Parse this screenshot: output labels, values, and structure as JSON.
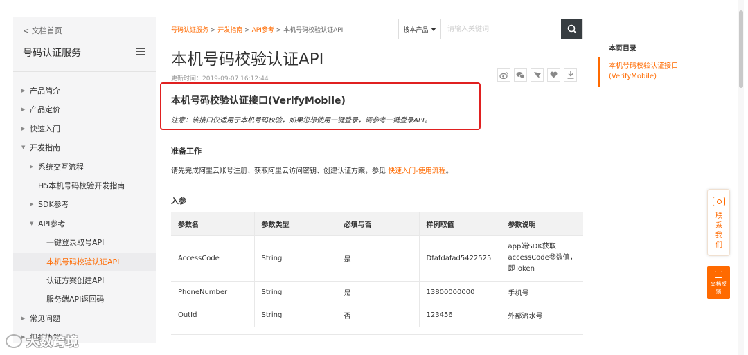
{
  "sidebar": {
    "back_link": "< 文档首页",
    "title": "号码认证服务",
    "items": [
      {
        "label": "产品简介",
        "has_arrow": true
      },
      {
        "label": "产品定价",
        "has_arrow": true
      },
      {
        "label": "快速入门",
        "has_arrow": true
      },
      {
        "label": "开发指南",
        "has_arrow": true,
        "expanded": true
      },
      {
        "label": "系统交互流程",
        "has_arrow": true
      },
      {
        "label": "H5本机号码校验开发指南",
        "has_arrow": false
      },
      {
        "label": "SDK参考",
        "has_arrow": true
      },
      {
        "label": "API参考",
        "has_arrow": true,
        "expanded": true
      },
      {
        "label": "一键登录取号API",
        "has_arrow": false
      },
      {
        "label": "本机号码校验认证API",
        "has_arrow": false,
        "active": true
      },
      {
        "label": "认证方案创建API",
        "has_arrow": false
      },
      {
        "label": "服务端API返回码",
        "has_arrow": false
      },
      {
        "label": "常见问题",
        "has_arrow": true
      },
      {
        "label": "相关协议",
        "has_arrow": true
      }
    ]
  },
  "breadcrumb": {
    "link1": "号码认证服务",
    "link2": "开发指南",
    "link3": "API参考",
    "separator": " > ",
    "current": "本机号码校验认证API"
  },
  "search": {
    "scope_label": "搜本产品",
    "placeholder": "请输入关键词"
  },
  "doc": {
    "title": "本机号码校验认证API",
    "updated": "更新时间：2019-09-07 16:12:44",
    "api_heading": "本机号码校验认证接口(VerifyMobile)",
    "note": "注意：该接口仅适用于本机号码校验，如果您想使用一键登录，请参考一键登录API。",
    "prep_heading": "准备工作",
    "prep_text": "请先完成阿里云账号注册、获取阿里云访问密钥、创建认证方案，参见 ",
    "prep_link": "快速入门-使用流程",
    "prep_end": "。",
    "params_heading": "入参"
  },
  "params_table": {
    "headers": [
      "参数名",
      "参数类型",
      "必填与否",
      "样例取值",
      "参数说明"
    ],
    "rows": [
      [
        "AccessCode",
        "String",
        "是",
        "Dfafdafad5422525",
        "app端SDK获取accessCode参数值，即Token"
      ],
      [
        "PhoneNumber",
        "String",
        "是",
        "13800000000",
        "手机号"
      ],
      [
        "OutId",
        "String",
        "否",
        "123456",
        "外部流水号"
      ]
    ]
  },
  "toc": {
    "title": "本页目录",
    "items": [
      "本机号码校验认证接口(VerifyMobile)"
    ]
  },
  "widgets": {
    "contact": "联系我们",
    "feedback": "文档反馈"
  },
  "watermark": "大数跨境",
  "colors": {
    "accent": "#ff6a00",
    "highlight_border": "#e02020",
    "search_button": "#373d41"
  }
}
